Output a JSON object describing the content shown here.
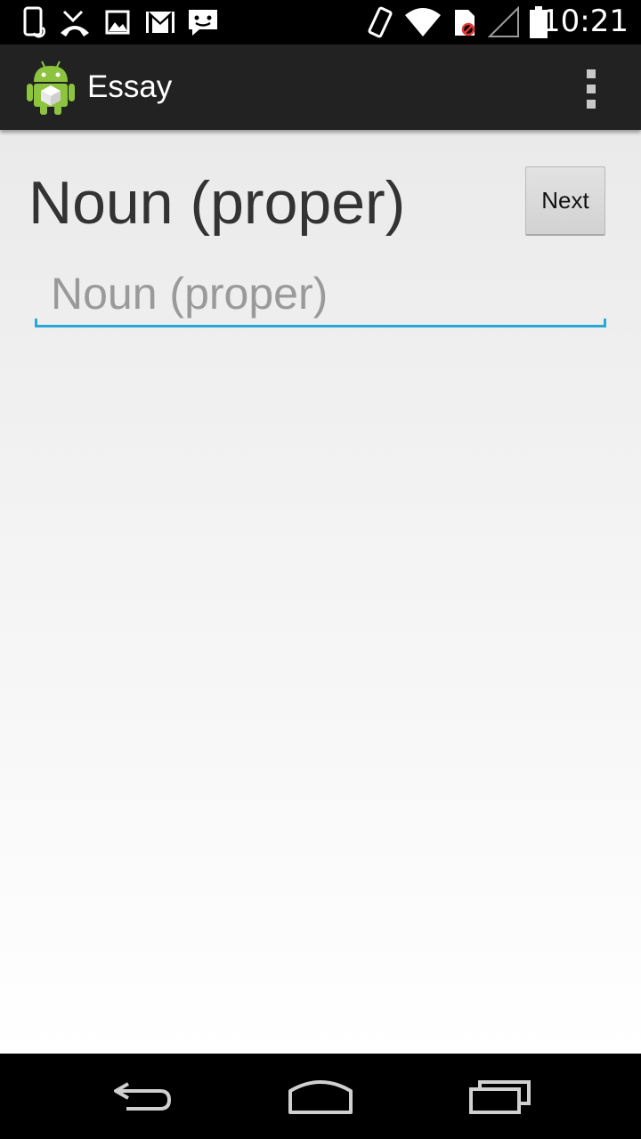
{
  "status_bar": {
    "time": "10:21",
    "icons": [
      "phone-sync-icon",
      "missed-call-icon",
      "image-icon",
      "gmail-icon",
      "sms-icon",
      "vibrate-icon",
      "wifi-icon",
      "no-sim-icon",
      "signal-icon",
      "battery-icon"
    ]
  },
  "action_bar": {
    "title": "Essay",
    "app_icon": "android-app-icon",
    "overflow_icon": "overflow-menu-icon"
  },
  "main": {
    "heading": "Noun (proper)",
    "next_label": "Next",
    "input": {
      "value": "",
      "placeholder": "Noun (proper)"
    }
  },
  "colors": {
    "action_bar_bg": "#222222",
    "accent": "#2aa7d6",
    "heading_text": "#333333"
  },
  "nav_bar": {
    "buttons": [
      "back-icon",
      "home-icon",
      "recents-icon"
    ]
  }
}
